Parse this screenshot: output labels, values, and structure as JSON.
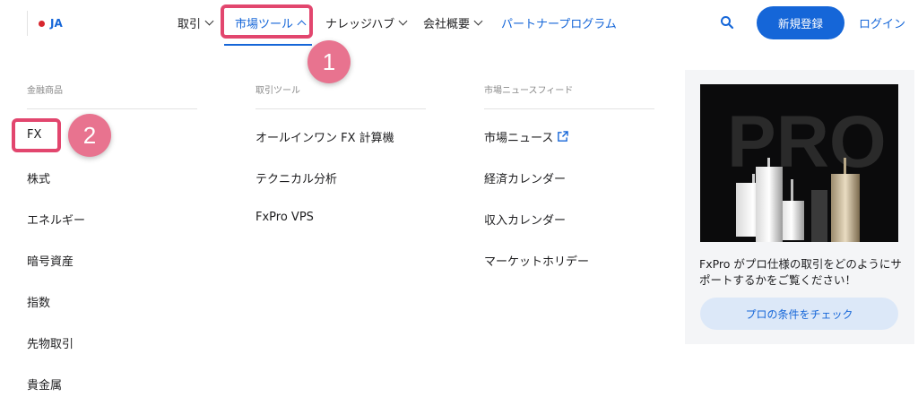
{
  "header": {
    "language": "JA",
    "nav": [
      {
        "label": "取引",
        "has_dropdown": true,
        "active": false
      },
      {
        "label": "市場ツール",
        "has_dropdown": true,
        "active": true
      },
      {
        "label": "ナレッジハブ",
        "has_dropdown": true,
        "active": false
      },
      {
        "label": "会社概要",
        "has_dropdown": true,
        "active": false
      },
      {
        "label": "パートナープログラム",
        "has_dropdown": false,
        "active": false
      }
    ],
    "search_icon": "search-icon",
    "register_label": "新規登録",
    "login_label": "ログイン"
  },
  "annotations": {
    "badge_1": "1",
    "badge_2": "2"
  },
  "menu": {
    "columns": [
      {
        "title": "金融商品",
        "items": [
          "FX",
          "株式",
          "エネルギー",
          "暗号資産",
          "指数",
          "先物取引",
          "貴金属"
        ]
      },
      {
        "title": "取引ツール",
        "items": [
          "オールインワン FX 計算機",
          "テクニカル分析",
          "FxPro VPS"
        ]
      },
      {
        "title": "市場ニュースフィード",
        "items": [
          "市場ニュース",
          "経済カレンダー",
          "収入カレンダー",
          "マーケットホリデー"
        ]
      }
    ]
  },
  "promo": {
    "image_text": "PRO",
    "description": "FxPro がプロ仕様の取引をどのようにサポートするかをご覧ください！",
    "button_label": "プロの条件をチェック"
  },
  "colors": {
    "accent": "#1566d8",
    "highlight": "#e2466e",
    "badge": "#e8738f"
  }
}
